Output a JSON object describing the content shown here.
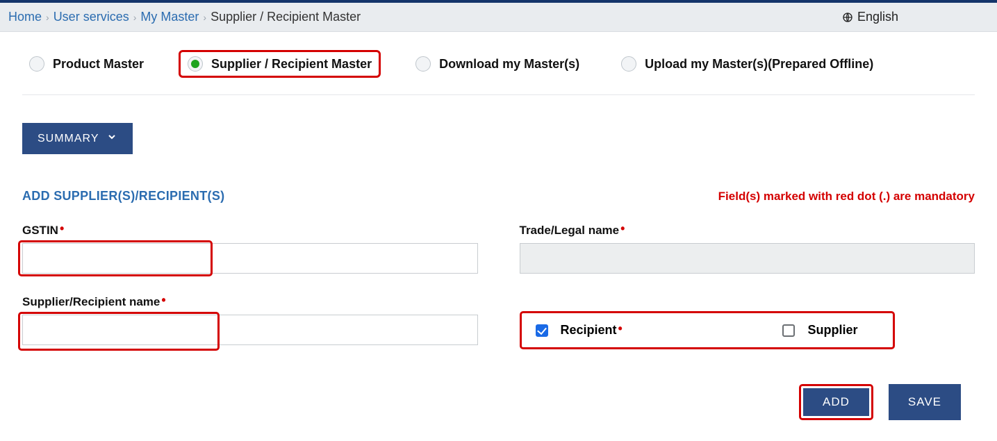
{
  "breadcrumb": {
    "home": "Home",
    "user_services": "User services",
    "my_master": "My Master",
    "current": "Supplier / Recipient Master"
  },
  "language": "English",
  "tabs": {
    "product_master": "Product Master",
    "supplier_recipient_master": "Supplier / Recipient Master",
    "download_master": "Download my Master(s)",
    "upload_master": "Upload my Master(s)(Prepared Offline)"
  },
  "summary_button": "SUMMARY",
  "section_title": "ADD SUPPLIER(S)/RECIPIENT(S)",
  "mandatory_note": "Field(s) marked with red dot (.) are mandatory",
  "fields": {
    "gstin_label": "GSTIN",
    "trade_name_label": "Trade/Legal name",
    "sr_name_label": "Supplier/Recipient name",
    "recipient_label": "Recipient",
    "supplier_label": "Supplier"
  },
  "buttons": {
    "add": "ADD",
    "save": "SAVE"
  }
}
